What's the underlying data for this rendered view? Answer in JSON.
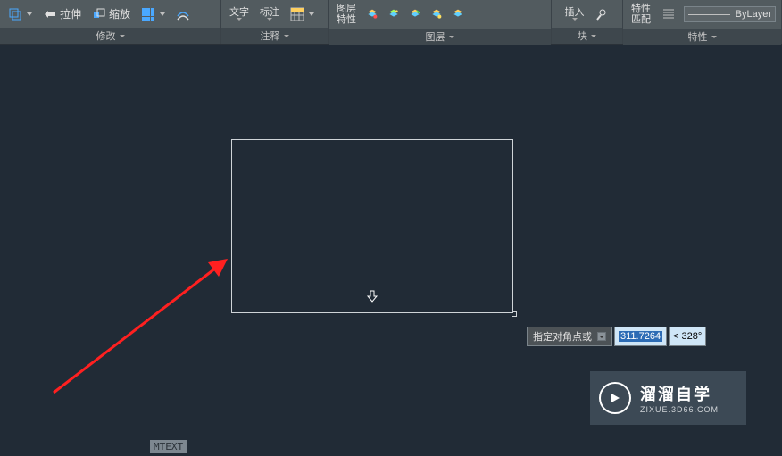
{
  "ribbon": {
    "modify": {
      "stretch": "拉伸",
      "scale": "缩放",
      "label": "修改"
    },
    "annotate": {
      "text": "文字",
      "dim": "标注",
      "label": "注释"
    },
    "layers": {
      "props": "图层\n特性",
      "label": "图层"
    },
    "blocks": {
      "insert": "插入",
      "label": "块"
    },
    "properties": {
      "match": "特性\n匹配",
      "bylayer": "ByLayer",
      "label": "特性"
    }
  },
  "dynamic_input": {
    "prompt": "指定对角点或",
    "value": "311.7264",
    "angle": "< 328°"
  },
  "cmd": "MTEXT",
  "watermark": {
    "title": "溜溜自学",
    "url": "ZIXUE.3D66.COM"
  }
}
